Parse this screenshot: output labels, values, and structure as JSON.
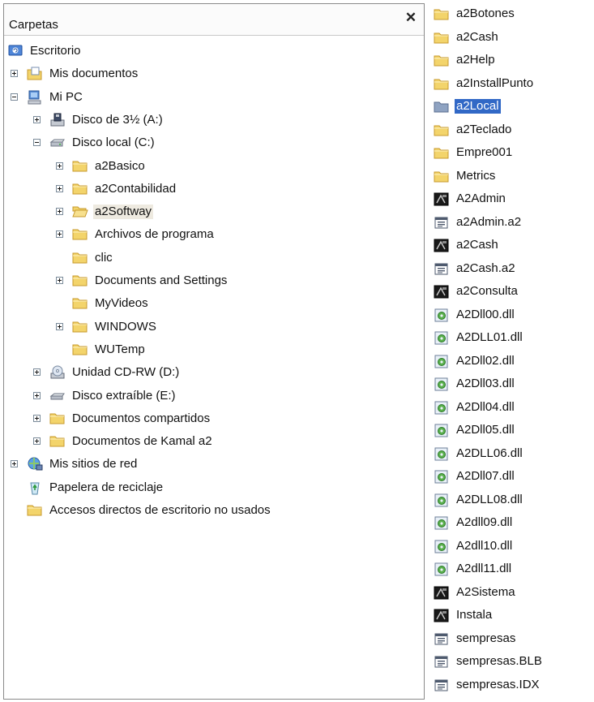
{
  "folders_pane": {
    "title": "Carpetas",
    "close_glyph": "✕"
  },
  "tree": [
    {
      "label": "Escritorio",
      "icon": "desktop-icon",
      "level": 0,
      "expander": "none"
    },
    {
      "label": "Mis documentos",
      "icon": "my-documents-icon",
      "level": 1,
      "expander": "plus"
    },
    {
      "label": "Mi PC",
      "icon": "my-computer-icon",
      "level": 1,
      "expander": "minus"
    },
    {
      "label": "Disco de 3½ (A:)",
      "icon": "floppy-drive-icon",
      "level": 2,
      "expander": "plus"
    },
    {
      "label": "Disco local (C:)",
      "icon": "hard-drive-icon",
      "level": 2,
      "expander": "minus"
    },
    {
      "label": "a2Basico",
      "icon": "folder-icon",
      "level": 3,
      "expander": "plus"
    },
    {
      "label": "a2Contabilidad",
      "icon": "folder-icon",
      "level": 3,
      "expander": "plus"
    },
    {
      "label": "a2Softway",
      "icon": "folder-open-icon",
      "level": 3,
      "expander": "plus",
      "highlight": true
    },
    {
      "label": "Archivos de programa",
      "icon": "folder-icon",
      "level": 3,
      "expander": "plus"
    },
    {
      "label": "clic",
      "icon": "folder-icon",
      "level": 3,
      "expander": "none"
    },
    {
      "label": "Documents and Settings",
      "icon": "folder-icon",
      "level": 3,
      "expander": "plus"
    },
    {
      "label": "MyVideos",
      "icon": "folder-icon",
      "level": 3,
      "expander": "none"
    },
    {
      "label": "WINDOWS",
      "icon": "folder-icon",
      "level": 3,
      "expander": "plus"
    },
    {
      "label": "WUTemp",
      "icon": "folder-icon",
      "level": 3,
      "expander": "none"
    },
    {
      "label": "Unidad CD-RW (D:)",
      "icon": "cd-drive-icon",
      "level": 2,
      "expander": "plus"
    },
    {
      "label": "Disco extraíble (E:)",
      "icon": "removable-drive-icon",
      "level": 2,
      "expander": "plus"
    },
    {
      "label": "Documentos compartidos",
      "icon": "folder-icon",
      "level": 2,
      "expander": "plus"
    },
    {
      "label": "Documentos de Kamal a2",
      "icon": "folder-icon",
      "level": 2,
      "expander": "plus"
    },
    {
      "label": "Mis sitios de red",
      "icon": "network-places-icon",
      "level": 1,
      "expander": "plus"
    },
    {
      "label": "Papelera de reciclaje",
      "icon": "recycle-bin-icon",
      "level": 1,
      "expander": "none"
    },
    {
      "label": "Accesos directos de escritorio no usados",
      "icon": "folder-icon",
      "level": 1,
      "expander": "none"
    }
  ],
  "files": [
    {
      "label": "a2Botones",
      "icon": "folder-icon"
    },
    {
      "label": "a2Cash",
      "icon": "folder-icon"
    },
    {
      "label": "a2Help",
      "icon": "folder-icon"
    },
    {
      "label": "a2InstallPunto",
      "icon": "folder-icon"
    },
    {
      "label": "a2Local",
      "icon": "folder-selected-icon",
      "selected": true
    },
    {
      "label": "a2Teclado",
      "icon": "folder-icon"
    },
    {
      "label": "Empre001",
      "icon": "folder-icon"
    },
    {
      "label": "Metrics",
      "icon": "folder-icon"
    },
    {
      "label": "A2Admin",
      "icon": "executable-icon"
    },
    {
      "label": "a2Admin.a2",
      "icon": "config-file-icon"
    },
    {
      "label": "a2Cash",
      "icon": "executable-icon"
    },
    {
      "label": "a2Cash.a2",
      "icon": "config-file-icon"
    },
    {
      "label": "a2Consulta",
      "icon": "executable-icon"
    },
    {
      "label": "A2Dll00.dll",
      "icon": "dll-icon"
    },
    {
      "label": "A2DLL01.dll",
      "icon": "dll-icon"
    },
    {
      "label": "A2Dll02.dll",
      "icon": "dll-icon"
    },
    {
      "label": "A2Dll03.dll",
      "icon": "dll-icon"
    },
    {
      "label": "A2Dll04.dll",
      "icon": "dll-icon"
    },
    {
      "label": "A2Dll05.dll",
      "icon": "dll-icon"
    },
    {
      "label": "A2DLL06.dll",
      "icon": "dll-icon"
    },
    {
      "label": "A2Dll07.dll",
      "icon": "dll-icon"
    },
    {
      "label": "A2DLL08.dll",
      "icon": "dll-icon"
    },
    {
      "label": "A2dll09.dll",
      "icon": "dll-icon"
    },
    {
      "label": "A2dll10.dll",
      "icon": "dll-icon"
    },
    {
      "label": "A2dll11.dll",
      "icon": "dll-icon"
    },
    {
      "label": "A2Sistema",
      "icon": "executable-icon"
    },
    {
      "label": "Instala",
      "icon": "executable-icon"
    },
    {
      "label": "sempresas",
      "icon": "config-file-icon"
    },
    {
      "label": "sempresas.BLB",
      "icon": "config-file-icon"
    },
    {
      "label": "sempresas.IDX",
      "icon": "config-file-icon"
    }
  ],
  "colors": {
    "folder": "#f3d46b",
    "folder_edge": "#c79a2c",
    "selection": "#3168c6",
    "highlight": "#eeeae0"
  }
}
